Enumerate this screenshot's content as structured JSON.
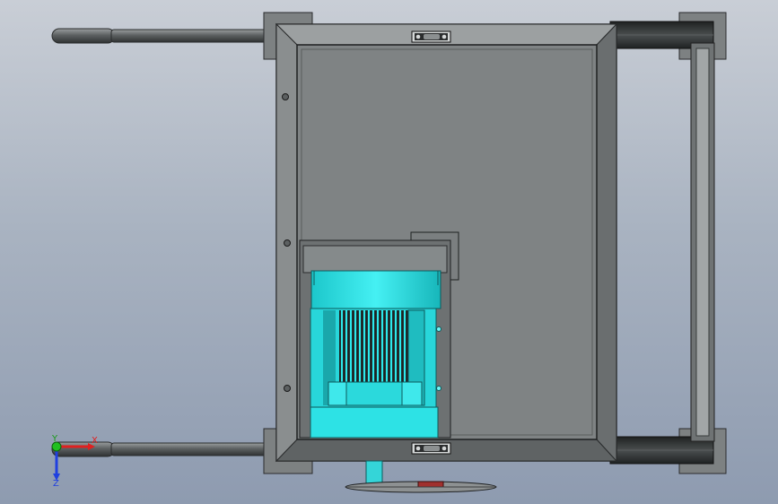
{
  "viewport": {
    "background_top": "#c9ced6",
    "background_bottom": "#8e9bb0"
  },
  "colors": {
    "steel_dark": "#3f4142",
    "steel_mid": "#6a6e6f",
    "steel_light": "#9ea3a4",
    "frame_face": "#7b7f80",
    "motor_cyan": "#2fe6e9",
    "motor_cyan_dark": "#139fa3",
    "axis_x": "#e02020",
    "axis_y": "#20c020",
    "axis_z": "#2040e0"
  },
  "triad": {
    "x_label": "X",
    "y_label": "Y",
    "z_label": "Z"
  }
}
